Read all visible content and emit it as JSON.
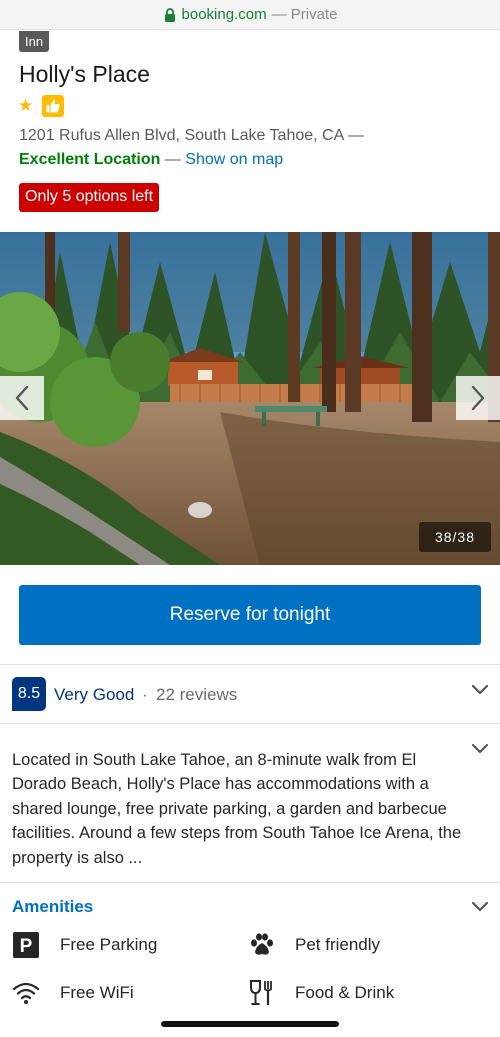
{
  "browser": {
    "domain": "booking.com",
    "private_label": "— Private"
  },
  "property": {
    "type_badge": "Inn",
    "name": "Holly's Place",
    "address": "1201 Rufus Allen Blvd, South Lake Tahoe, CA —",
    "location_rating": "Excellent Location",
    "location_separator": "—",
    "show_on_map": "Show on map",
    "urgency": "Only 5 options left"
  },
  "gallery": {
    "counter": "38/38"
  },
  "cta": {
    "reserve_label": "Reserve for tonight"
  },
  "reviews": {
    "score": "8.5",
    "word": "Very Good",
    "dot": "·",
    "count": "22 reviews"
  },
  "description": "Located in South Lake Tahoe, an 8-minute walk from El Dorado Beach, Holly's Place has accommodations with a shared lounge, free private parking, a garden and barbecue facilities. Around a few steps from South Tahoe Ice Arena, the property is also ...",
  "amenities": {
    "title": "Amenities",
    "items": [
      {
        "icon": "parking-icon",
        "label": "Free Parking"
      },
      {
        "icon": "paw-icon",
        "label": "Pet friendly"
      },
      {
        "icon": "wifi-icon",
        "label": "Free WiFi"
      },
      {
        "icon": "food-drink-icon",
        "label": "Food & Drink"
      }
    ]
  },
  "colors": {
    "brand_blue": "#0071c2",
    "dark_blue": "#003580",
    "urgency_red": "#cc0000",
    "excellent_green": "#008009",
    "star_yellow": "#febb02"
  }
}
